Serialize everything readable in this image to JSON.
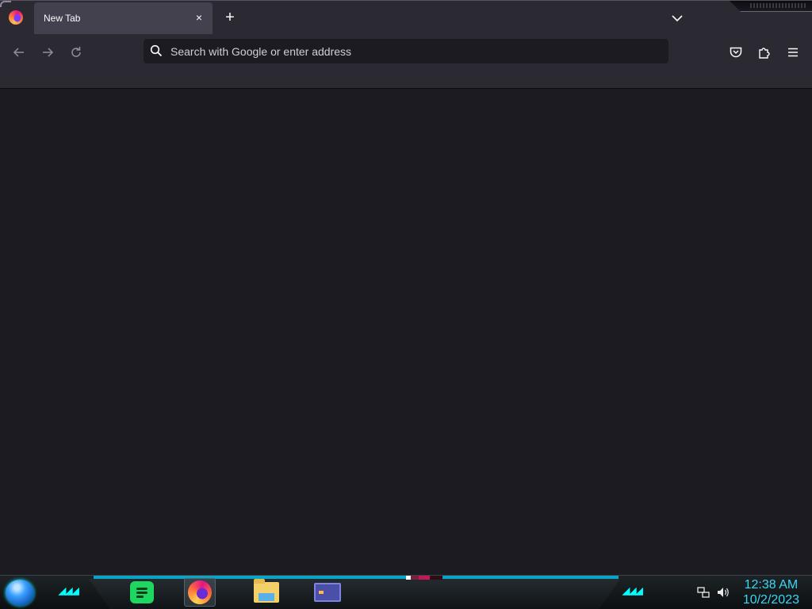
{
  "browser": {
    "tab": {
      "title": "New Tab",
      "close_label": "×"
    },
    "new_tab_label": "+",
    "urlbar": {
      "placeholder": "Search with Google or enter address",
      "value": ""
    }
  },
  "icons": {
    "back": "arrow-left-icon",
    "forward": "arrow-right-icon",
    "reload": "reload-icon",
    "search": "search-icon",
    "pocket": "pocket-icon",
    "extensions": "puzzle-icon",
    "menu": "hamburger-icon",
    "list_tabs": "chevron-down-icon"
  },
  "taskbar": {
    "apps": [
      {
        "name": "Spotify"
      },
      {
        "name": "Firefox"
      },
      {
        "name": "File Explorer"
      },
      {
        "name": "App"
      }
    ],
    "clock": {
      "time": "12:38 AM",
      "date": "10/2/2023"
    }
  },
  "colors": {
    "toolbar": "#2b2a33",
    "content": "#1c1b22",
    "tab_selected": "#42414d",
    "clock_text": "#3ad7f3",
    "accent_cyan": "#0aa3c8"
  }
}
